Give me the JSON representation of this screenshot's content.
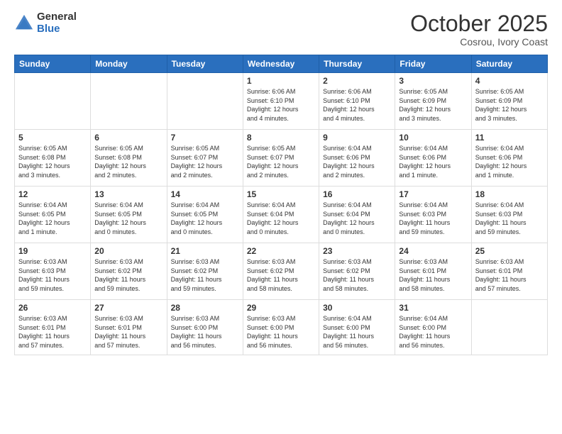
{
  "logo": {
    "general": "General",
    "blue": "Blue"
  },
  "header": {
    "month": "October 2025",
    "location": "Cosrou, Ivory Coast"
  },
  "weekdays": [
    "Sunday",
    "Monday",
    "Tuesday",
    "Wednesday",
    "Thursday",
    "Friday",
    "Saturday"
  ],
  "weeks": [
    [
      {
        "day": "",
        "info": ""
      },
      {
        "day": "",
        "info": ""
      },
      {
        "day": "",
        "info": ""
      },
      {
        "day": "1",
        "info": "Sunrise: 6:06 AM\nSunset: 6:10 PM\nDaylight: 12 hours\nand 4 minutes."
      },
      {
        "day": "2",
        "info": "Sunrise: 6:06 AM\nSunset: 6:10 PM\nDaylight: 12 hours\nand 4 minutes."
      },
      {
        "day": "3",
        "info": "Sunrise: 6:05 AM\nSunset: 6:09 PM\nDaylight: 12 hours\nand 3 minutes."
      },
      {
        "day": "4",
        "info": "Sunrise: 6:05 AM\nSunset: 6:09 PM\nDaylight: 12 hours\nand 3 minutes."
      }
    ],
    [
      {
        "day": "5",
        "info": "Sunrise: 6:05 AM\nSunset: 6:08 PM\nDaylight: 12 hours\nand 3 minutes."
      },
      {
        "day": "6",
        "info": "Sunrise: 6:05 AM\nSunset: 6:08 PM\nDaylight: 12 hours\nand 2 minutes."
      },
      {
        "day": "7",
        "info": "Sunrise: 6:05 AM\nSunset: 6:07 PM\nDaylight: 12 hours\nand 2 minutes."
      },
      {
        "day": "8",
        "info": "Sunrise: 6:05 AM\nSunset: 6:07 PM\nDaylight: 12 hours\nand 2 minutes."
      },
      {
        "day": "9",
        "info": "Sunrise: 6:04 AM\nSunset: 6:06 PM\nDaylight: 12 hours\nand 2 minutes."
      },
      {
        "day": "10",
        "info": "Sunrise: 6:04 AM\nSunset: 6:06 PM\nDaylight: 12 hours\nand 1 minute."
      },
      {
        "day": "11",
        "info": "Sunrise: 6:04 AM\nSunset: 6:06 PM\nDaylight: 12 hours\nand 1 minute."
      }
    ],
    [
      {
        "day": "12",
        "info": "Sunrise: 6:04 AM\nSunset: 6:05 PM\nDaylight: 12 hours\nand 1 minute."
      },
      {
        "day": "13",
        "info": "Sunrise: 6:04 AM\nSunset: 6:05 PM\nDaylight: 12 hours\nand 0 minutes."
      },
      {
        "day": "14",
        "info": "Sunrise: 6:04 AM\nSunset: 6:05 PM\nDaylight: 12 hours\nand 0 minutes."
      },
      {
        "day": "15",
        "info": "Sunrise: 6:04 AM\nSunset: 6:04 PM\nDaylight: 12 hours\nand 0 minutes."
      },
      {
        "day": "16",
        "info": "Sunrise: 6:04 AM\nSunset: 6:04 PM\nDaylight: 12 hours\nand 0 minutes."
      },
      {
        "day": "17",
        "info": "Sunrise: 6:04 AM\nSunset: 6:03 PM\nDaylight: 11 hours\nand 59 minutes."
      },
      {
        "day": "18",
        "info": "Sunrise: 6:04 AM\nSunset: 6:03 PM\nDaylight: 11 hours\nand 59 minutes."
      }
    ],
    [
      {
        "day": "19",
        "info": "Sunrise: 6:03 AM\nSunset: 6:03 PM\nDaylight: 11 hours\nand 59 minutes."
      },
      {
        "day": "20",
        "info": "Sunrise: 6:03 AM\nSunset: 6:02 PM\nDaylight: 11 hours\nand 59 minutes."
      },
      {
        "day": "21",
        "info": "Sunrise: 6:03 AM\nSunset: 6:02 PM\nDaylight: 11 hours\nand 59 minutes."
      },
      {
        "day": "22",
        "info": "Sunrise: 6:03 AM\nSunset: 6:02 PM\nDaylight: 11 hours\nand 58 minutes."
      },
      {
        "day": "23",
        "info": "Sunrise: 6:03 AM\nSunset: 6:02 PM\nDaylight: 11 hours\nand 58 minutes."
      },
      {
        "day": "24",
        "info": "Sunrise: 6:03 AM\nSunset: 6:01 PM\nDaylight: 11 hours\nand 58 minutes."
      },
      {
        "day": "25",
        "info": "Sunrise: 6:03 AM\nSunset: 6:01 PM\nDaylight: 11 hours\nand 57 minutes."
      }
    ],
    [
      {
        "day": "26",
        "info": "Sunrise: 6:03 AM\nSunset: 6:01 PM\nDaylight: 11 hours\nand 57 minutes."
      },
      {
        "day": "27",
        "info": "Sunrise: 6:03 AM\nSunset: 6:01 PM\nDaylight: 11 hours\nand 57 minutes."
      },
      {
        "day": "28",
        "info": "Sunrise: 6:03 AM\nSunset: 6:00 PM\nDaylight: 11 hours\nand 56 minutes."
      },
      {
        "day": "29",
        "info": "Sunrise: 6:03 AM\nSunset: 6:00 PM\nDaylight: 11 hours\nand 56 minutes."
      },
      {
        "day": "30",
        "info": "Sunrise: 6:04 AM\nSunset: 6:00 PM\nDaylight: 11 hours\nand 56 minutes."
      },
      {
        "day": "31",
        "info": "Sunrise: 6:04 AM\nSunset: 6:00 PM\nDaylight: 11 hours\nand 56 minutes."
      },
      {
        "day": "",
        "info": ""
      }
    ]
  ]
}
